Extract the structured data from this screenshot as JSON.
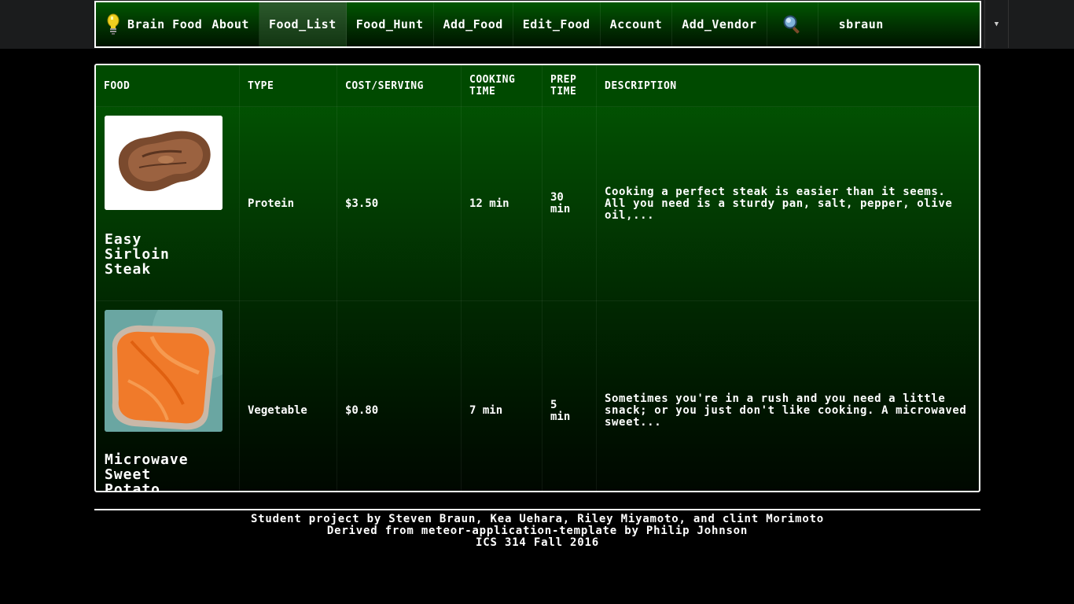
{
  "nav": {
    "brand": "Brain Food",
    "items": [
      {
        "label": "About"
      },
      {
        "label": "Food_List"
      },
      {
        "label": "Food_Hunt"
      },
      {
        "label": "Add_Food"
      },
      {
        "label": "Edit_Food"
      },
      {
        "label": "Account"
      },
      {
        "label": "Add_Vendor"
      }
    ],
    "active_item": "Food_List",
    "search_icon": "magnifier-icon",
    "user": "sbraun",
    "dropdown_icon": "caret-down-icon"
  },
  "table": {
    "headers": {
      "food": "FOOD",
      "type": "TYPE",
      "cost": "COST/SERVING",
      "cooking_time_1": "COOKING",
      "cooking_time_2": "TIME",
      "prep_time_1": "PREP",
      "prep_time_2": "TIME",
      "description": "DESCRIPTION"
    },
    "rows": [
      {
        "name_1": "Easy",
        "name_2": "Sirloin",
        "name_3": "Steak",
        "type": "Protein",
        "cost": "$3.50",
        "cooking_time": "12 min",
        "prep_time_1": "30",
        "prep_time_2": "min",
        "description": "Cooking a perfect steak is easier than it seems. All you need is a sturdy pan, salt, pepper, olive oil,..."
      },
      {
        "name_1": "Microwave",
        "name_2": "Sweet",
        "name_3": "Potato",
        "type": "Vegetable",
        "cost": "$0.80",
        "cooking_time": "7 min",
        "prep_time_1": "5",
        "prep_time_2": "min",
        "description": "Sometimes you're in a rush and you need a little snack; or you just don't like cooking. A microwaved sweet..."
      }
    ]
  },
  "footer": {
    "line1": "Student project by Steven Braun, Kea Uehara, Riley Miyamoto, and clint Morimoto",
    "line2": "Derived from meteor-application-template by Philip Johnson",
    "line3": "ICS 314 Fall 2016"
  },
  "colors": {
    "header_green": "#015601",
    "table_header": "#004a00",
    "background": "#000000",
    "border": "#ffffff",
    "bulb": "#f0d020"
  }
}
